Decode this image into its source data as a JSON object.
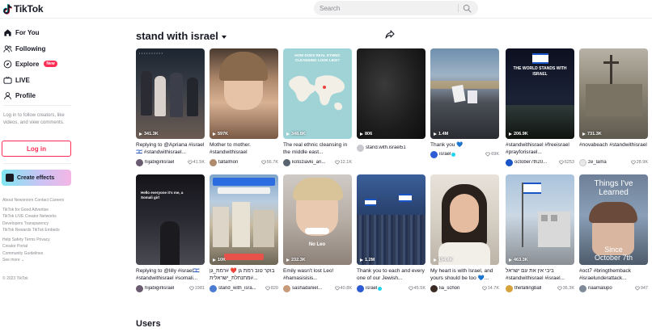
{
  "app": {
    "logo_text": "TikTok"
  },
  "search": {
    "placeholder": "Search"
  },
  "sidebar": {
    "nav": [
      {
        "label": "For You",
        "icon": "home-icon"
      },
      {
        "label": "Following",
        "icon": "following-icon"
      },
      {
        "label": "Explore",
        "icon": "compass-icon",
        "badge": "New"
      },
      {
        "label": "LIVE",
        "icon": "live-icon"
      },
      {
        "label": "Profile",
        "icon": "profile-icon"
      }
    ],
    "login_prompt": "Log in to follow creators, like videos, and view comments.",
    "login_button": "Log in",
    "effects_button": "Create effects",
    "footer": {
      "row1": [
        "About",
        "Newsroom",
        "Contact",
        "Careers"
      ],
      "row2": [
        "TikTok for Good",
        "Advertise"
      ],
      "row3": [
        "TikTok LIVE Creator Networks"
      ],
      "row4": [
        "Developers",
        "Transparency"
      ],
      "row5": [
        "TikTok Rewards",
        "TikTok Embeds"
      ],
      "row6": [
        "Help",
        "Safety",
        "Terms",
        "Privacy"
      ],
      "row7": [
        "Creator Portal"
      ],
      "row8": [
        "Community Guidelines"
      ],
      "see_more": "See more ⌄",
      "copyright": "© 2023 TikTok"
    }
  },
  "main": {
    "tag_title": "stand with israel",
    "users_heading": "Users",
    "videos": [
      {
        "views": "341.3K",
        "caption": "Replying to @Apriana #israel🇮🇱 #standwithisrael...",
        "author": "hijabigirlisrael",
        "verified": false,
        "likes": "41.5K",
        "thumb_text": "",
        "theme": "t1"
      },
      {
        "views": "597K",
        "caption": "Mother to mother. #standwithisrael",
        "author": "taltalmon",
        "verified": false,
        "likes": "56.7K",
        "thumb_text": "",
        "theme": "t2"
      },
      {
        "views": "348.8K",
        "caption": "The real ethnic cleansing in the middle east...",
        "author": "kotoziavki_an...",
        "verified": false,
        "likes": "12.1K",
        "thumb_text": "HOW DOES REAL ETHNIC CLEANSING LOOK LIKE?",
        "theme": "t3"
      },
      {
        "views": "806",
        "caption": "",
        "author": "stand.with.israel51",
        "verified": false,
        "likes": "",
        "thumb_text": "",
        "theme": "t4"
      },
      {
        "views": "1.4M",
        "caption": "Thank you 💙",
        "author": "israel",
        "verified": true,
        "likes": "69K",
        "thumb_text": "",
        "theme": "t5"
      },
      {
        "views": "206.9K",
        "caption": "#standwithisrael #freeisrael #prayforisrael...",
        "author": "october7th20...",
        "verified": false,
        "likes": "6253",
        "thumb_text": "THE WORLD STANDS WITH ISRAEL",
        "theme": "t6"
      },
      {
        "views": "731.3K",
        "caption": "#novabeach #standwithisrael",
        "author": "ze_lama",
        "verified": false,
        "likes": "28.9K",
        "thumb_text": "",
        "theme": "t7"
      },
      {
        "views": "",
        "caption": "Replying to @lilly #israel🇮🇱 #standwithisrael #somali...",
        "author": "hijabigirlisrael",
        "verified": false,
        "likes": "1981",
        "thumb_text": "Hello everyone it's me, a Somali girl",
        "theme": "t8"
      },
      {
        "views": "10K",
        "caption": "בוקר טוב רמת גן ❤️ #רמת_גן #מתנחלת_ישראלית...",
        "author": "stand_with_isra...",
        "verified": false,
        "likes": "820",
        "thumb_text": "",
        "theme": "t9"
      },
      {
        "views": "232.3K",
        "caption": "Emily wasn't lost Leo! #hamasisisis...",
        "author": "sashadaniel...",
        "verified": false,
        "likes": "40.8K",
        "thumb_text": "No Leo",
        "theme": "t10"
      },
      {
        "views": "1.2M",
        "caption": "Thank you to each and every one of our Jewish...",
        "author": "israel",
        "verified": true,
        "likes": "45.5K",
        "thumb_text": "",
        "theme": "t11"
      },
      {
        "views": "194.4K",
        "caption": "My heart is with Israel, and yours should be too 💙...",
        "author": "lia_schon",
        "verified": false,
        "likes": "14.7K",
        "thumb_text": "",
        "theme": "t12"
      },
      {
        "views": "463.3K",
        "caption": "ביבי אין את עם ישראל #standwithisrael #israel...",
        "author": "thefallingball",
        "verified": false,
        "likes": "36.3K",
        "thumb_text": "",
        "theme": "t13"
      },
      {
        "views": "",
        "caption": "#oct7 #bringthemback #israelunderattack...",
        "author": "naamalupo",
        "verified": false,
        "likes": "947",
        "thumb_text": "Things I've Learned",
        "theme": "t14"
      }
    ]
  },
  "colors": {
    "accent": "#fe2c55",
    "verified": "#20d5ec",
    "text": "#161823",
    "muted": "#8a8b91"
  }
}
